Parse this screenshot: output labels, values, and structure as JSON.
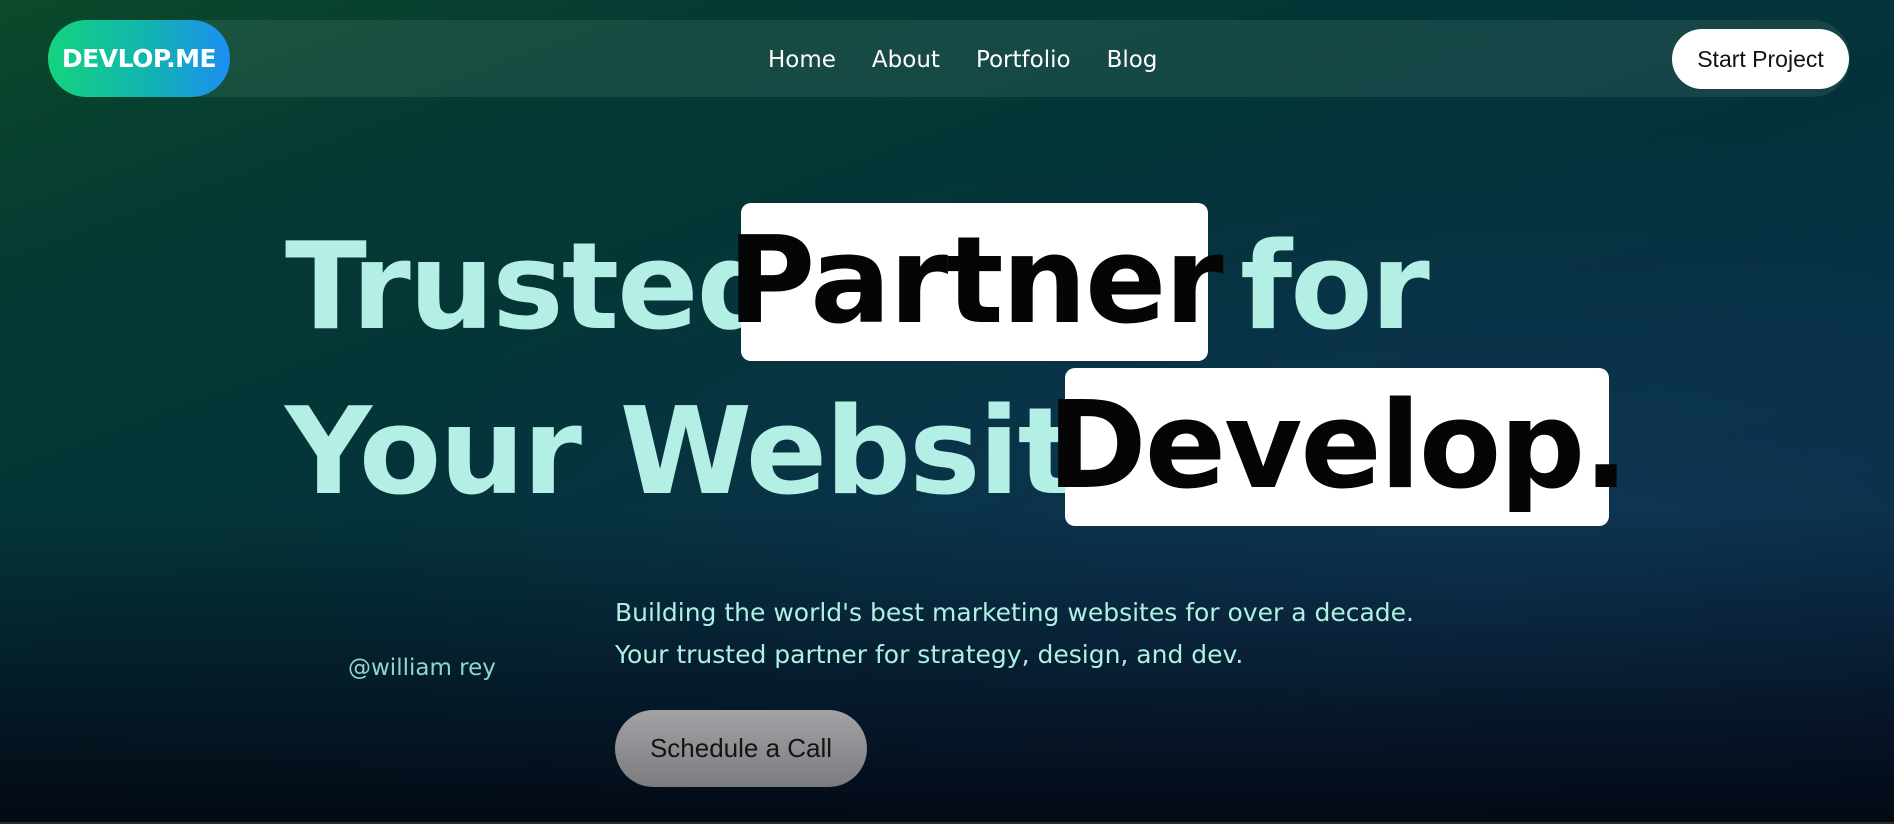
{
  "nav": {
    "logo": "DEVLOP.ME",
    "links": [
      "Home",
      "About",
      "Portfolio",
      "Blog"
    ],
    "cta": "Start Project"
  },
  "hero": {
    "line1": {
      "word1": "Trusted",
      "boxed": "Partner",
      "word2": "for"
    },
    "line2": {
      "word1": "Your Website",
      "boxed": "Develop."
    },
    "handle": "@william rey",
    "description": "Building the world's best marketing websites for over a decade. Your trusted partner for strategy, design, and dev.",
    "cta": "Schedule a Call"
  },
  "colors": {
    "accent_text": "#b3efe4",
    "logo_gradient_start": "#14d37e",
    "logo_gradient_end": "#1c8ef2"
  }
}
